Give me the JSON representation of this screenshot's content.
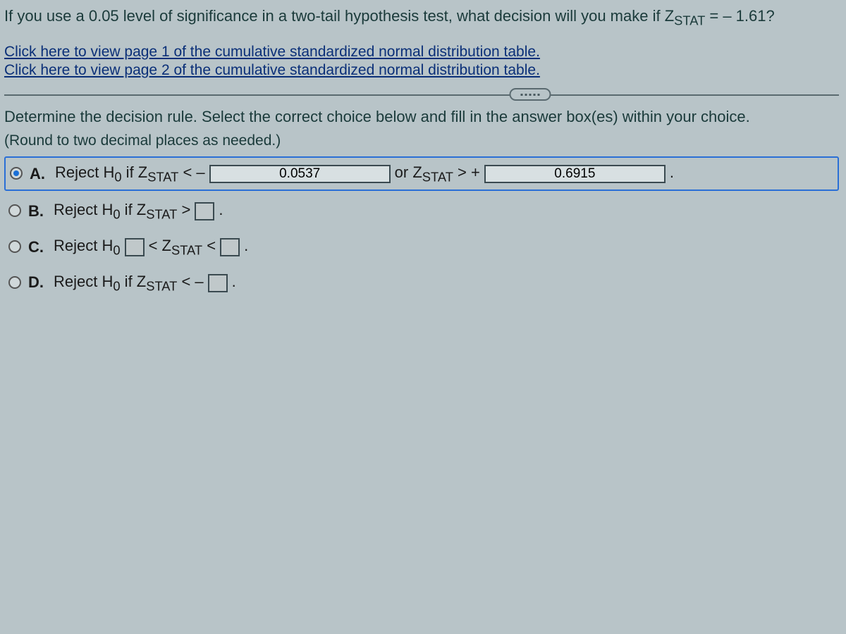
{
  "question": {
    "prefix": "If you use a 0.05 level of significance in a two-tail hypothesis test, what decision will you make if Z",
    "sub": "STAT",
    "suffix": " = – 1.61?"
  },
  "links": {
    "page1": "Click here to view page 1 of the cumulative standardized normal distribution table.",
    "page2": "Click here to view page 2 of the cumulative standardized normal distribution table."
  },
  "instruction": "Determine the decision rule. Select the correct choice below and fill in the answer box(es) within your choice.",
  "roundNote": "(Round to two decimal places as needed.)",
  "choices": {
    "A": {
      "letter": "A.",
      "p1": "Reject H",
      "sub0": "0",
      "p2": " if Z",
      "subStat": "STAT",
      "p3": " < – ",
      "val1": "0.0537",
      "p4": " or Z",
      "p5": " > + ",
      "val2": "0.6915",
      "p6": "."
    },
    "B": {
      "letter": "B.",
      "p1": "Reject H",
      "sub0": "0",
      "p2": " if Z",
      "subStat": "STAT",
      "p3": " > ",
      "p4": "."
    },
    "C": {
      "letter": "C.",
      "p1": "Reject H",
      "sub0": "0",
      "p2": " ",
      "p3": " < Z",
      "subStat": "STAT",
      "p4": " < ",
      "p5": "."
    },
    "D": {
      "letter": "D.",
      "p1": "Reject H",
      "sub0": "0",
      "p2": " if Z",
      "subStat": "STAT",
      "p3": " < – ",
      "p4": "."
    }
  }
}
